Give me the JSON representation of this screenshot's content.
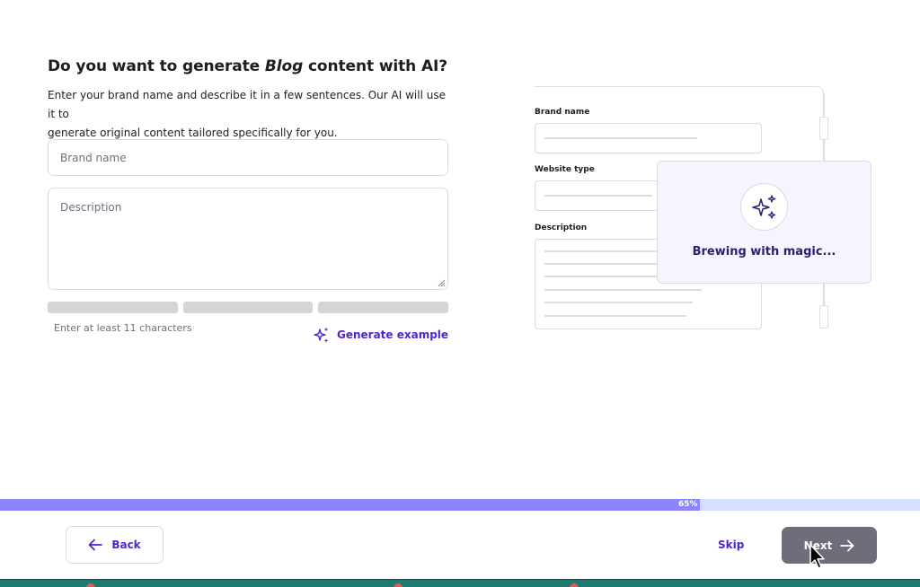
{
  "header": {
    "title_before": "Do you want to generate ",
    "title_em": "Blog",
    "title_after": " content with AI?",
    "subtitle_line1": "Enter your brand name and describe it in a few sentences. Our AI will use it to",
    "subtitle_line2": "generate original content tailored specifically for you."
  },
  "form": {
    "brand_placeholder": "Brand name",
    "brand_value": "",
    "description_placeholder": "Description",
    "description_value": "",
    "hint": "Enter at least 11 characters",
    "generate_label": "Generate example"
  },
  "illustration": {
    "brand_label": "Brand name",
    "website_type_label": "Website type",
    "description_label": "Description",
    "magic_text": "Brewing with magic..."
  },
  "progress": {
    "percent": 65,
    "label": "65%"
  },
  "footer": {
    "back_label": "Back",
    "skip_label": "Skip",
    "next_label": "Next"
  },
  "colors": {
    "accent": "#5025d1",
    "progress_fill": "#8c85ff",
    "progress_track": "#d5dfff",
    "next_disabled": "#6d6e7a"
  },
  "icons": {
    "back": "arrow-left-icon",
    "next": "arrow-right-icon",
    "generate": "sparkle-icon",
    "magic": "sparkle-icon"
  }
}
